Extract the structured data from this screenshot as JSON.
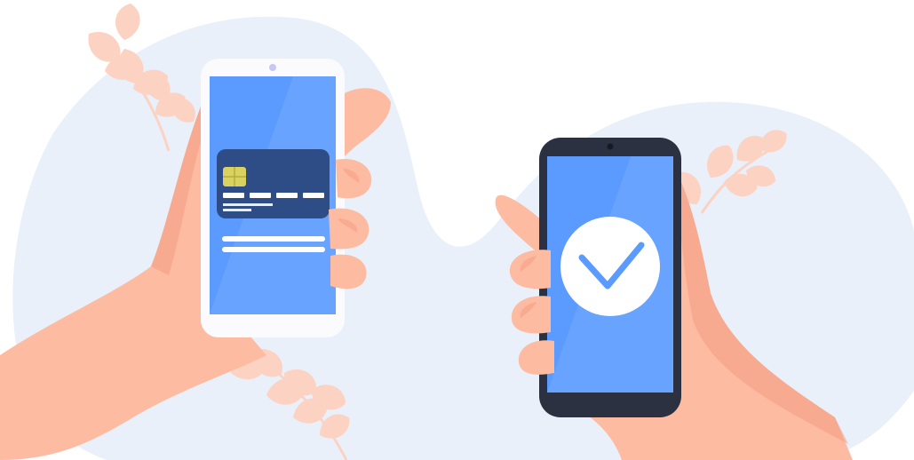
{
  "illustration": {
    "colors": {
      "background": "#ffffff",
      "blob": "#e9f0fa",
      "leaf": "#fcd2c3",
      "skin": "#fdbba2",
      "skin_shadow": "#f39c7f",
      "phone_white": "#fbfbfd",
      "phone_dark": "#2b3140",
      "screen_blue": "#5b9bff",
      "card": "#2e4c86",
      "chip": "#d9d160",
      "check": "#5b9bff",
      "check_circle": "#ffffff"
    },
    "left_phone": {
      "icons": [
        "credit-card-icon",
        "card-chip-icon"
      ],
      "card_number_groups": 4
    },
    "right_phone": {
      "icons": [
        "checkmark-icon"
      ],
      "status": "payment-success"
    }
  }
}
